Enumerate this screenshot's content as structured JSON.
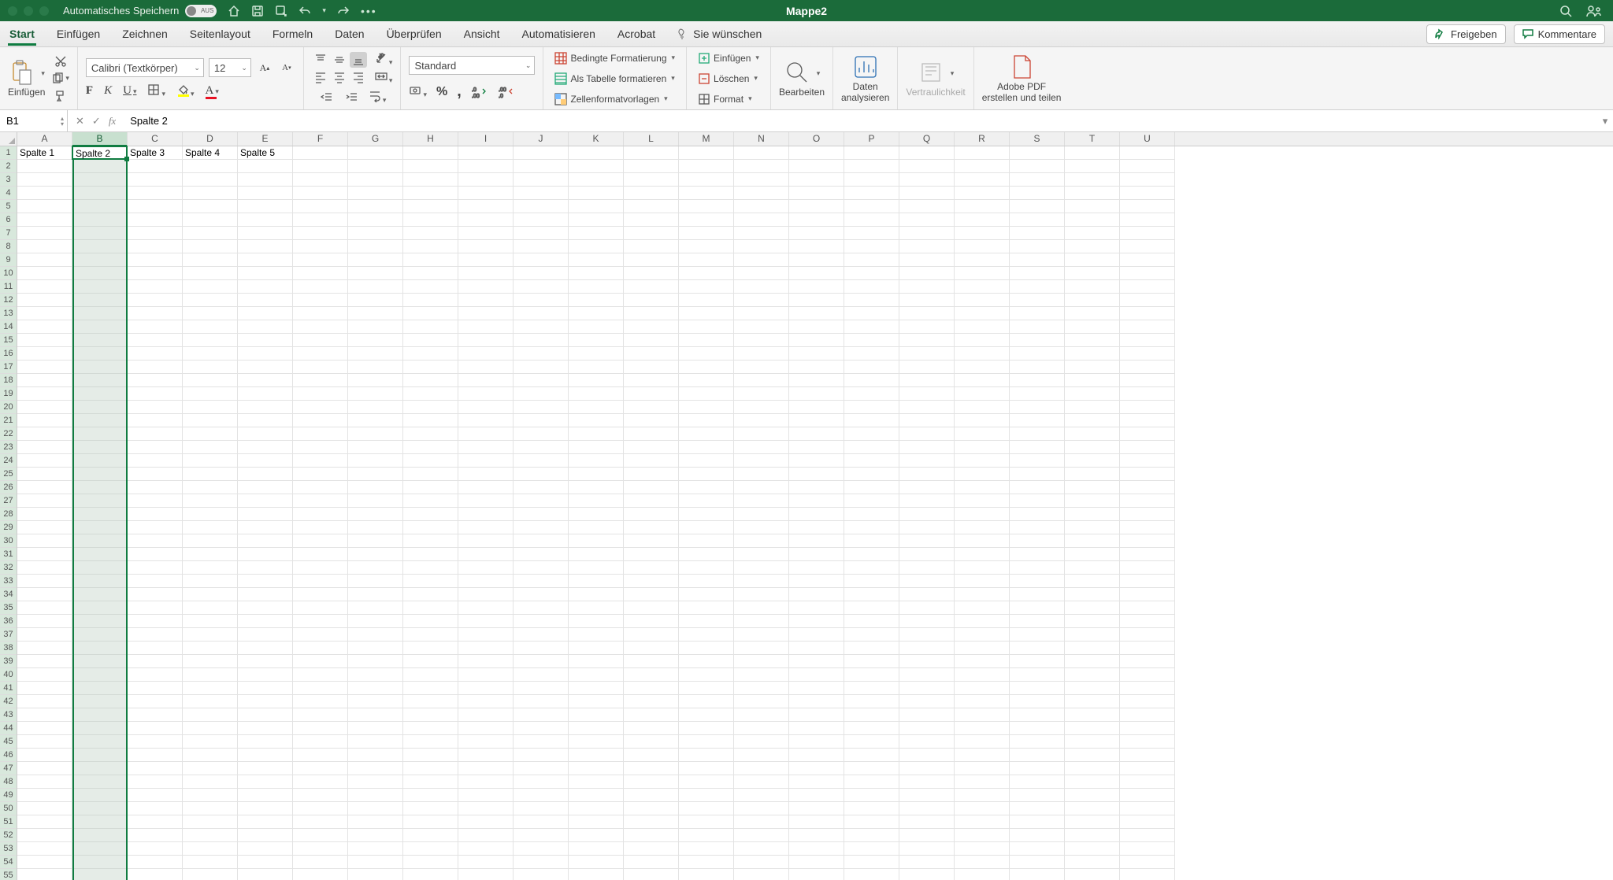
{
  "titlebar": {
    "autosave_label": "Automatisches Speichern",
    "autosave_state": "AUS",
    "document_title": "Mappe2"
  },
  "tabs": {
    "items": [
      "Start",
      "Einfügen",
      "Zeichnen",
      "Seitenlayout",
      "Formeln",
      "Daten",
      "Überprüfen",
      "Ansicht",
      "Automatisieren",
      "Acrobat"
    ],
    "active_index": 0,
    "tell_me": "Sie wünschen",
    "share": "Freigeben",
    "comments": "Kommentare"
  },
  "ribbon": {
    "paste": "Einfügen",
    "font_name": "Calibri (Textkörper)",
    "font_size": "12",
    "number_format": "Standard",
    "cond_format": "Bedingte Formatierung",
    "as_table": "Als Tabelle formatieren",
    "cell_styles": "Zellenformatvorlagen",
    "insert": "Einfügen",
    "delete": "Löschen",
    "format": "Format",
    "edit": "Bearbeiten",
    "analyze": "Daten\nanalysieren",
    "sensitivity": "Vertraulichkeit",
    "adobe": "Adobe PDF\nerstellen und teilen"
  },
  "formula_bar": {
    "name_box": "B1",
    "fx_label": "fx",
    "formula": "Spalte 2"
  },
  "grid": {
    "columns": [
      "A",
      "B",
      "C",
      "D",
      "E",
      "F",
      "G",
      "H",
      "I",
      "J",
      "K",
      "L",
      "M",
      "N",
      "O",
      "P",
      "Q",
      "R",
      "S",
      "T",
      "U"
    ],
    "selected_col_index": 1,
    "row_count": 55,
    "row1": [
      "Spalte 1",
      "Spalte 2",
      "Spalte 3",
      "Spalte 4",
      "Spalte 5"
    ],
    "active_cell": "B1"
  }
}
